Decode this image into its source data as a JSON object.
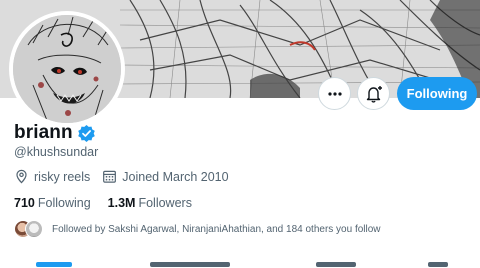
{
  "profile": {
    "display_name": "briann",
    "handle": "@khushsundar",
    "location": "risky reels",
    "joined": "Joined March 2010",
    "following_count": "710",
    "following_label": "Following",
    "followers_count": "1.3M",
    "followers_label": "Followers",
    "followed_by": "Followed by Sakshi Agarwal, NiranjaniAhathian, and 184 others you follow"
  },
  "actions": {
    "more_icon": "more-horizontal-icon",
    "notify_icon": "bell-plus-icon",
    "follow_label": "Following"
  },
  "colors": {
    "accent": "#1d9bf0",
    "secondary_text": "#536471",
    "primary_text": "#0f1419",
    "border": "#cfd9de"
  }
}
